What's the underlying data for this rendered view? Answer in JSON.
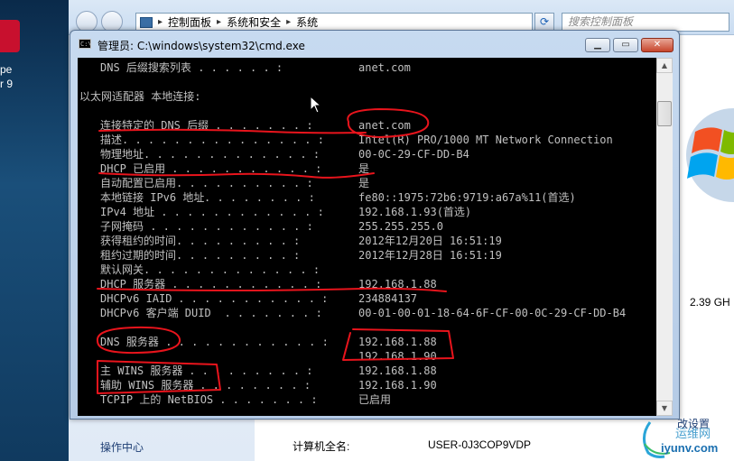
{
  "desktop": {
    "label_line1": "pe",
    "label_line2": "r 9"
  },
  "explorer": {
    "breadcrumb": [
      "控制面板",
      "系统和安全",
      "系统"
    ],
    "search_placeholder": "搜索控制面板",
    "left_link_action_center": "操作中心",
    "computer_name_label": "计算机全名:",
    "computer_name_value": "USER-0J3COP9VDP",
    "cpu_speed_partial": "2.39 GH",
    "change_settings_partial": "改设置"
  },
  "cmd": {
    "title": "管理员: C:\\windows\\system32\\cmd.exe",
    "lines": [
      {
        "label": "DNS 后缀搜索列表",
        "dots": " . . . . . . :",
        "value": "anet.com",
        "indent": true
      },
      {
        "label": "",
        "dots": "",
        "value": "",
        "indent": false
      },
      {
        "label": "以太网适配器 本地连接:",
        "dots": "",
        "value": "",
        "indent": false
      },
      {
        "label": "",
        "dots": "",
        "value": "",
        "indent": false
      },
      {
        "label": "连接特定的 DNS 后缀",
        "dots": " . . . . . . . :",
        "value": "anet.com",
        "indent": true
      },
      {
        "label": "描述",
        "dots": ". . . . . . . . . . . . . . . :",
        "value": "Intel(R) PRO/1000 MT Network Connection",
        "indent": true
      },
      {
        "label": "物理地址",
        "dots": ". . . . . . . . . . . . . :",
        "value": "00-0C-29-CF-DD-B4",
        "indent": true
      },
      {
        "label": "DHCP 已启用",
        "dots": " . . . . . . . . . . . :",
        "value": "是",
        "indent": true
      },
      {
        "label": "自动配置已启用",
        "dots": ". . . . . . . . . . :",
        "value": "是",
        "indent": true
      },
      {
        "label": "本地链接 IPv6 地址",
        "dots": ". . . . . . . . :",
        "value": "fe80::1975:72b6:9719:a67a%11(首选)",
        "indent": true
      },
      {
        "label": "IPv4 地址",
        "dots": " . . . . . . . . . . . . :",
        "value": "192.168.1.93(首选)",
        "indent": true
      },
      {
        "label": "子网掩码",
        "dots": " . . . . . . . . . . . . :",
        "value": "255.255.255.0",
        "indent": true
      },
      {
        "label": "获得租约的时间",
        "dots": ". . . . . . . . . :",
        "value": "2012年12月20日 16:51:19",
        "indent": true
      },
      {
        "label": "租约过期的时间",
        "dots": ". . . . . . . . . :",
        "value": "2012年12月28日 16:51:19",
        "indent": true
      },
      {
        "label": "默认网关",
        "dots": ". . . . . . . . . . . . . :",
        "value": "",
        "indent": true
      },
      {
        "label": "DHCP 服务器",
        "dots": " . . . . . . . . . . . :",
        "value": "192.168.1.88",
        "indent": true
      },
      {
        "label": "DHCPv6 IAID",
        "dots": " . . . . . . . . . . . :",
        "value": "234884137",
        "indent": true
      },
      {
        "label": "DHCPv6 客户端 DUID",
        "dots": "  . . . . . . . :",
        "value": "00-01-00-01-18-64-6F-CF-00-0C-29-CF-DD-B4",
        "indent": true
      },
      {
        "label": "",
        "dots": "",
        "value": "",
        "indent": false
      },
      {
        "label": "DNS 服务器",
        "dots": " . . . . . . . . . . . . :",
        "value": "192.168.1.88",
        "indent": true
      },
      {
        "label": "",
        "dots": "",
        "value": "192.168.1.90",
        "indent": true
      },
      {
        "label": "主 WINS 服务器",
        "dots": " . . . . . . . . . :",
        "value": "192.168.1.88",
        "indent": true
      },
      {
        "label": "辅助 WINS 服务器",
        "dots": " . . . . . . . . :",
        "value": "192.168.1.90",
        "indent": true
      },
      {
        "label": "TCPIP 上的 NetBIOS",
        "dots": " . . . . . . . :",
        "value": "已启用",
        "indent": true
      }
    ]
  },
  "colors": {
    "console_bg": "#000000",
    "console_text": "#c0c0c0",
    "annotation": "#e8141c",
    "title_bar": "#c7daf0"
  },
  "watermark": {
    "text_top": "运维网",
    "text_bottom": "iyunv.com"
  }
}
